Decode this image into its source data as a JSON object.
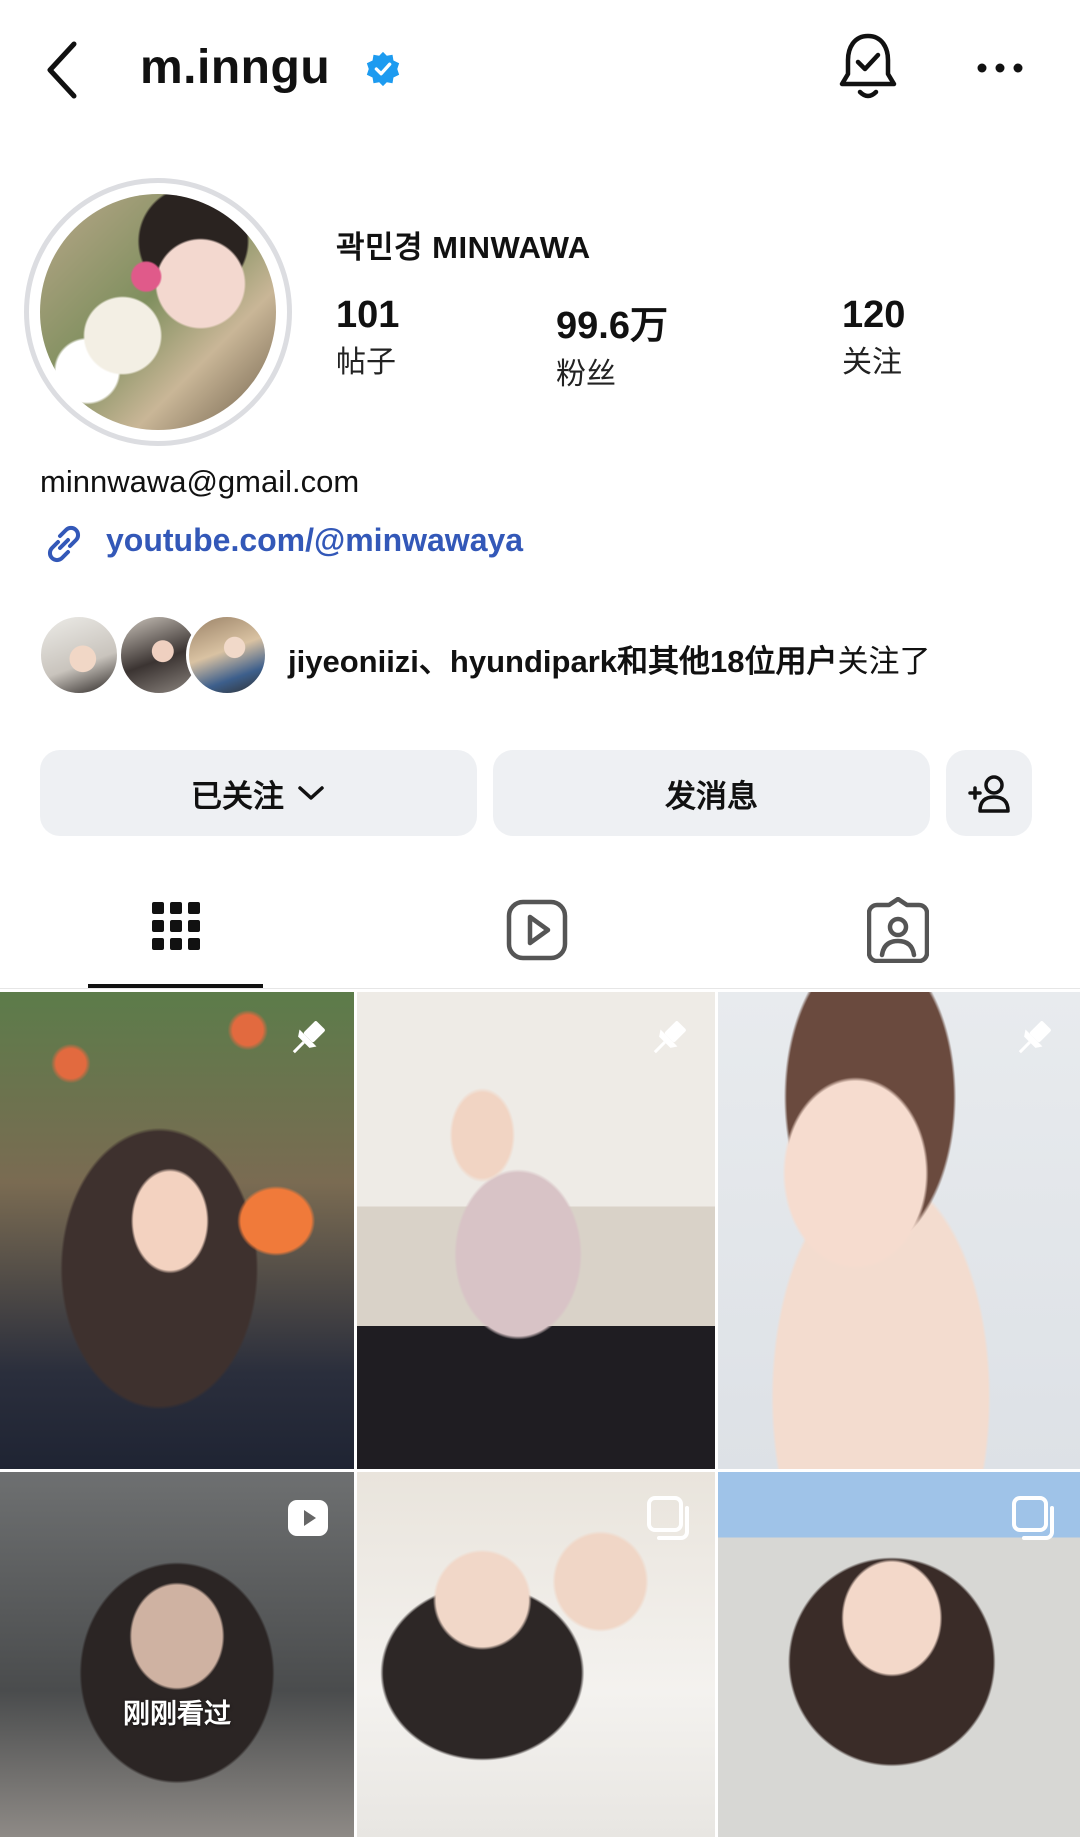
{
  "header": {
    "username": "m.inngu"
  },
  "profile": {
    "full_name": "곽민경 MINWAWA",
    "stats": [
      {
        "value": "101",
        "label": "帖子"
      },
      {
        "value": "99.6万",
        "label": "粉丝"
      },
      {
        "value": "120",
        "label": "关注"
      }
    ],
    "email": "minnwawa@gmail.com",
    "link": "youtube.com/@minwawaya"
  },
  "followed_by": {
    "users": "jiyeoniizi、hyundipark",
    "rest": "和其他18位用户",
    "suffix": "关注了"
  },
  "actions": {
    "following_label": "已关注",
    "message_label": "发消息"
  },
  "tabs": [
    "posts-grid",
    "reels",
    "tagged"
  ],
  "posts": [
    {
      "type": "pinned"
    },
    {
      "type": "pinned"
    },
    {
      "type": "pinned"
    },
    {
      "type": "reel",
      "overlay": "刚刚看过"
    },
    {
      "type": "carousel"
    },
    {
      "type": "carousel"
    }
  ],
  "colors": {
    "link": "#3358b8",
    "verified": "#1d9bf0",
    "button_bg": "#eef0f3"
  }
}
